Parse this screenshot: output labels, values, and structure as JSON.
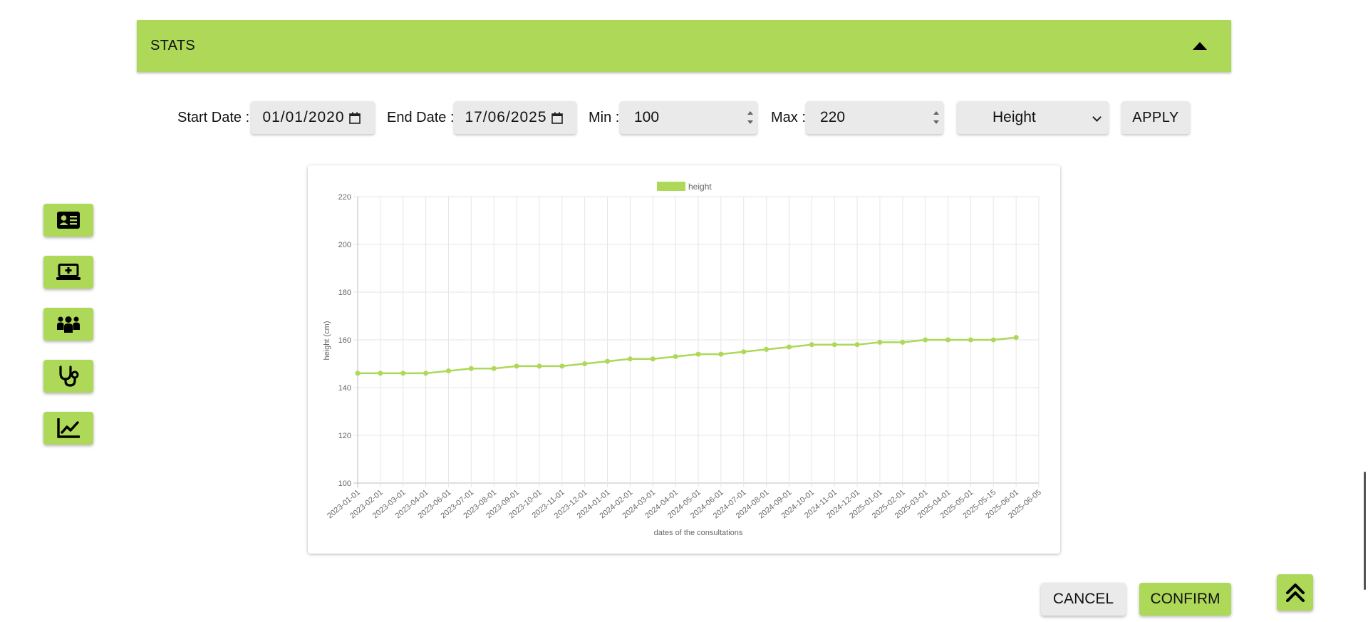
{
  "stats": {
    "title": "STATS"
  },
  "filters": {
    "start_label": "Start Date :",
    "start_value": "01/01/2020",
    "end_label": "End Date :",
    "end_value": "17/06/2025",
    "min_label": "Min :",
    "min_value": "100",
    "max_label": "Max :",
    "max_value": "220",
    "metric_value": "Height",
    "apply_label": "APPLY"
  },
  "sidenav": {
    "items": [
      {
        "icon": "id-card-icon"
      },
      {
        "icon": "laptop-medical-icon"
      },
      {
        "icon": "people-group-icon"
      },
      {
        "icon": "stethoscope-icon"
      },
      {
        "icon": "chart-line-icon"
      }
    ]
  },
  "actions": {
    "cancel_label": "CANCEL",
    "confirm_label": "CONFIRM"
  },
  "colors": {
    "accent": "#add858",
    "button_grey": "#eaeaea"
  },
  "chart_data": {
    "type": "line",
    "title": "",
    "xlabel": "dates of the consultations",
    "ylabel": "height (cm)",
    "ylim": [
      100,
      220
    ],
    "yticks": [
      100,
      120,
      140,
      160,
      180,
      200,
      220
    ],
    "grid": true,
    "legend": "top-center",
    "series": [
      {
        "name": "height",
        "color": "#add858",
        "values": [
          146,
          146,
          146,
          146,
          147,
          148,
          148,
          149,
          149,
          149,
          150,
          151,
          152,
          152,
          153,
          154,
          154,
          155,
          156,
          157,
          158,
          158,
          158,
          159,
          159,
          160,
          160,
          160,
          160,
          161
        ]
      }
    ],
    "x": [
      "2023-01-01",
      "2023-02-01",
      "2023-03-01",
      "2023-04-01",
      "2023-06-01",
      "2023-07-01",
      "2023-08-01",
      "2023-09-01",
      "2023-10-01",
      "2023-11-01",
      "2023-12-01",
      "2024-01-01",
      "2024-02-01",
      "2024-03-01",
      "2024-04-01",
      "2024-05-01",
      "2024-06-01",
      "2024-07-01",
      "2024-08-01",
      "2024-09-01",
      "2024-10-01",
      "2024-11-01",
      "2024-12-01",
      "2025-01-01",
      "2025-02-01",
      "2025-03-01",
      "2025-04-01",
      "2025-05-01",
      "2025-05-15",
      "2025-06-01",
      "2025-06-05"
    ]
  }
}
